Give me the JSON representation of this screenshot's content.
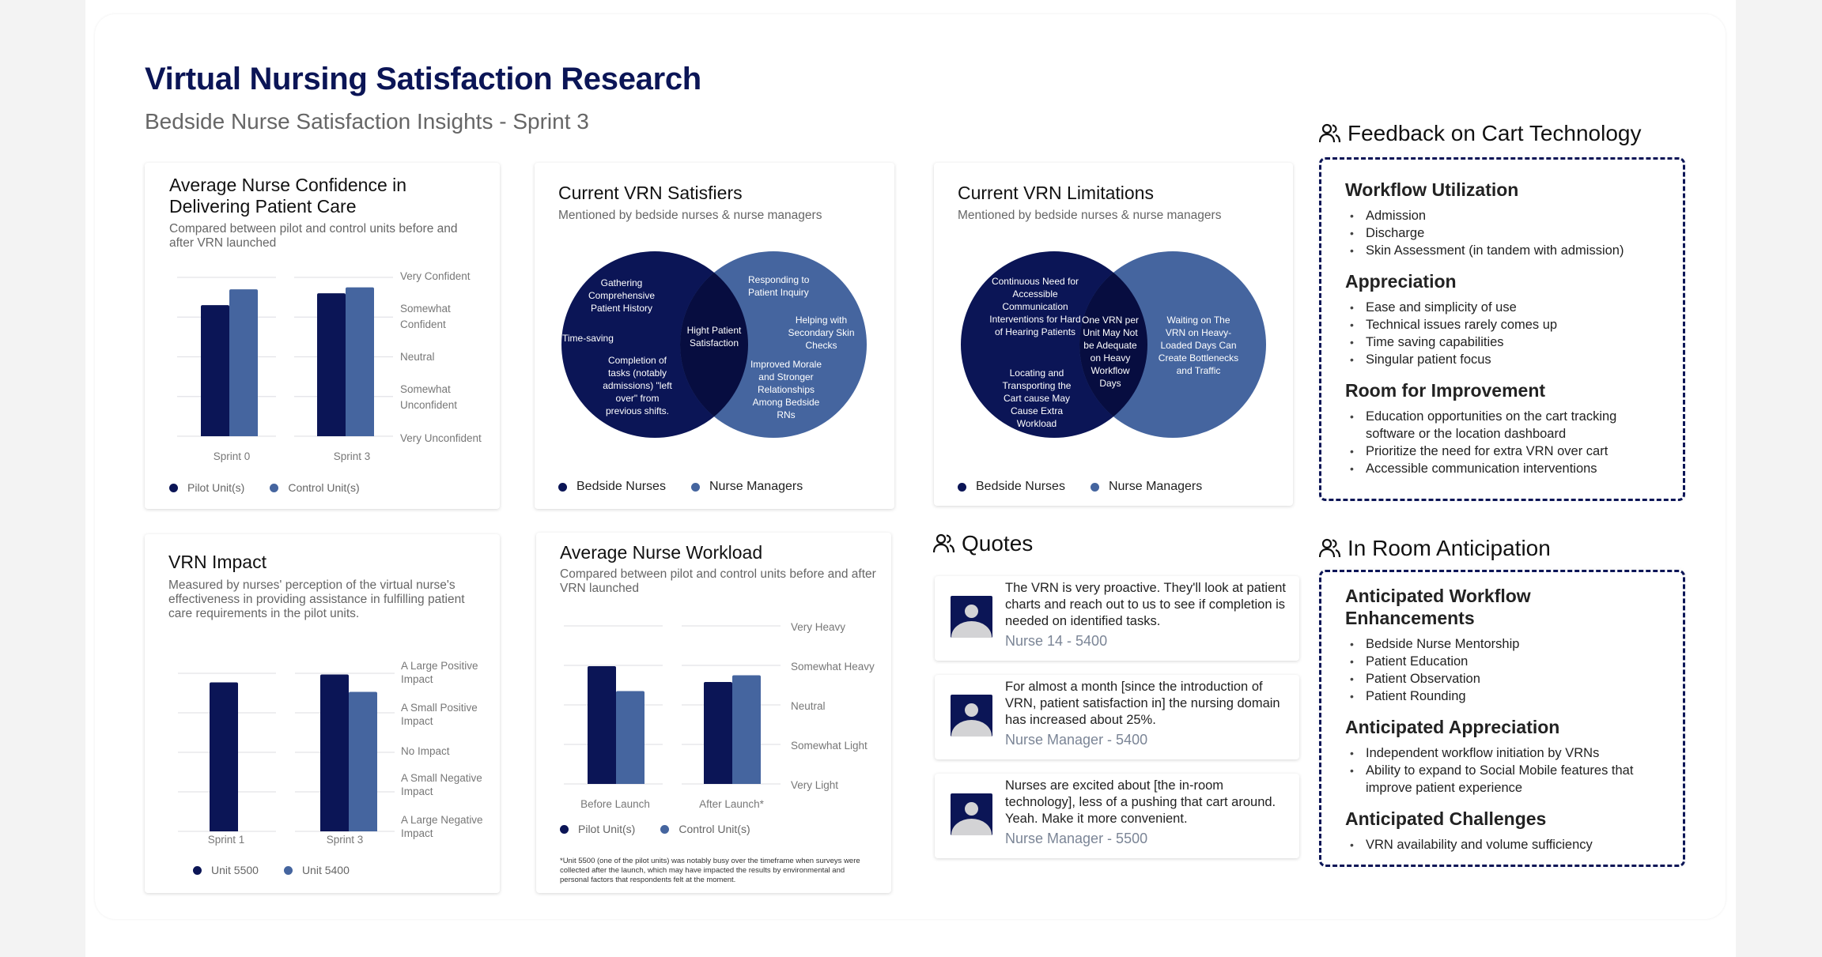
{
  "header": {
    "title": "Virtual Nursing Satisfaction Research",
    "subtitle": "Bedside Nurse Satisfaction Insights - Sprint 3"
  },
  "colors": {
    "navy": "#0b1556",
    "blue": "#45659f",
    "overlap": "#070d40"
  },
  "chart_data": [
    {
      "id": "confidence",
      "type": "bar",
      "title": "Average Nurse Confidence in Delivering Patient Care",
      "subtitle": "Compared between pilot and control units before and after VRN launched",
      "categories": [
        "Sprint 0",
        "Sprint 3"
      ],
      "y_scale": [
        "Very Unconfident",
        "Somewhat Unconfident",
        "Neutral",
        "Somewhat Confident",
        "Very Confident"
      ],
      "y_tick_labels": [
        "Very Confident",
        "Somewhat Confident",
        "Neutral",
        "Somewhat Unconfident",
        "Very Unconfident"
      ],
      "ylim": [
        1,
        5
      ],
      "grid": true,
      "series": [
        {
          "name": "Pilot Unit(s)",
          "color": "#0b1556",
          "values": [
            4.3,
            4.6
          ]
        },
        {
          "name": "Control Unit(s)",
          "color": "#45659f",
          "values": [
            4.7,
            4.75
          ]
        }
      ],
      "legend": "bottom"
    },
    {
      "id": "impact",
      "type": "bar",
      "title": "VRN Impact",
      "subtitle": "Measured by nurses' perception of the virtual nurse's effectiveness in providing assistance in fulfilling patient care requirements in the pilot units.",
      "categories": [
        "Sprint 1",
        "Sprint 3"
      ],
      "y_scale": [
        "A Large Negative Impact",
        "A Small Negative Impact",
        "No Impact",
        "A Small Positive Impact",
        "A Large Positive Impact"
      ],
      "y_tick_labels": [
        "A Large Positive Impact",
        "A Small Positive Impact",
        "No Impact",
        "A Small Negative Impact",
        "A Large Negative Impact"
      ],
      "ylim": [
        1,
        5
      ],
      "grid": true,
      "series": [
        {
          "name": "Unit 5500",
          "color": "#0b1556",
          "values": [
            4.77,
            4.97
          ]
        },
        {
          "name": "Unit 5400",
          "color": "#45659f",
          "values": [
            null,
            4.53
          ]
        }
      ],
      "legend": "bottom"
    },
    {
      "id": "workload",
      "type": "bar",
      "title": "Average Nurse Workload",
      "subtitle": "Compared between pilot and control units before and after VRN launched",
      "categories": [
        "Before Launch",
        "After Launch*"
      ],
      "y_scale": [
        "Very Light",
        "Somewhat Light",
        "Neutral",
        "Somewhat Heavy",
        "Very Heavy"
      ],
      "y_tick_labels": [
        "Very Heavy",
        "Somewhat Heavy",
        "Neutral",
        "Somewhat Light",
        "Very Light"
      ],
      "ylim": [
        1,
        5
      ],
      "grid": true,
      "series": [
        {
          "name": "Pilot Unit(s)",
          "color": "#0b1556",
          "values": [
            3.98,
            3.58
          ]
        },
        {
          "name": "Control Unit(s)",
          "color": "#45659f",
          "values": [
            3.35,
            3.75
          ]
        }
      ],
      "legend": "bottom",
      "footnote": "*Unit 5500 (one of the pilot units) was notably busy over the timeframe when surveys were collected after the launch, which may have impacted the results by environmental and personal factors that respondents felt at the moment."
    }
  ],
  "satisfiers": {
    "title": "Current VRN Satisfiers",
    "subtitle": "Mentioned by bedside nurses & nurse managers",
    "left": [
      "Gathering Comprehensive Patient History",
      "Time-saving",
      "Completion of tasks (notably admissions) \"left over\" from previous shifts."
    ],
    "overlap": [
      "Hight Patient Satisfaction"
    ],
    "right": [
      "Responding to Patient Inquiry",
      "Helping with Secondary Skin Checks",
      "Improved Morale and Stronger Relationships Among Bedside RNs"
    ],
    "legend": [
      "Bedside Nurses",
      "Nurse Managers"
    ]
  },
  "limitations": {
    "title": "Current VRN Limitations",
    "subtitle": "Mentioned by bedside nurses & nurse managers",
    "left": [
      "Continuous Need for Accessible Communication Interventions for Hard of Hearing Patients",
      "Locating and Transporting the Cart cause May Cause Extra Workload"
    ],
    "overlap": [
      "One VRN per Unit May Not be Adequate on Heavy Workflow Days"
    ],
    "right": [
      "Waiting on The VRN on Heavy-Loaded Days Can Create Bottlenecks and Traffic"
    ],
    "legend": [
      "Bedside Nurses",
      "Nurse Managers"
    ]
  },
  "quotes": {
    "title": "Quotes",
    "icon": "users-icon",
    "items": [
      {
        "text": "The VRN is very proactive. They'll look at patient charts and reach out to us to see if completion is needed on identified tasks.",
        "author": "Nurse 14 - 5400"
      },
      {
        "text": "For almost a month [since the introduction of VRN, patient satisfaction in] the nursing domain has increased about 25%.",
        "author": "Nurse Manager - 5400"
      },
      {
        "text": "Nurses are excited about [the in-room technology], less of a pushing that cart around. Yeah. Make it more convenient.",
        "author": "Nurse Manager - 5500"
      }
    ]
  },
  "feedback": {
    "title": "Feedback on Cart Technology",
    "icon": "users-icon",
    "sections": [
      {
        "heading": "Workflow Utilization",
        "items": [
          "Admission",
          "Discharge",
          "Skin Assessment (in tandem with admission)"
        ]
      },
      {
        "heading": "Appreciation",
        "items": [
          "Ease and simplicity of use",
          "Technical issues rarely comes up",
          "Time saving capabilities",
          "Singular patient focus"
        ]
      },
      {
        "heading": "Room for Improvement",
        "items": [
          "Education opportunities on the cart tracking software or the location dashboard",
          "Prioritize the need for extra VRN over cart",
          "Accessible communication interventions"
        ]
      }
    ]
  },
  "anticipation": {
    "title": "In Room Anticipation",
    "icon": "users-icon",
    "sections": [
      {
        "heading": "Anticipated Workflow Enhancements",
        "items": [
          "Bedside Nurse Mentorship",
          "Patient Education",
          "Patient Observation",
          "Patient Rounding"
        ]
      },
      {
        "heading": "Anticipated Appreciation",
        "items": [
          "Independent workflow initiation by VRNs",
          "Ability to expand to Social Mobile features that improve patient experience"
        ]
      },
      {
        "heading": "Anticipated Challenges",
        "items": [
          "VRN availability and volume sufficiency"
        ]
      }
    ]
  }
}
